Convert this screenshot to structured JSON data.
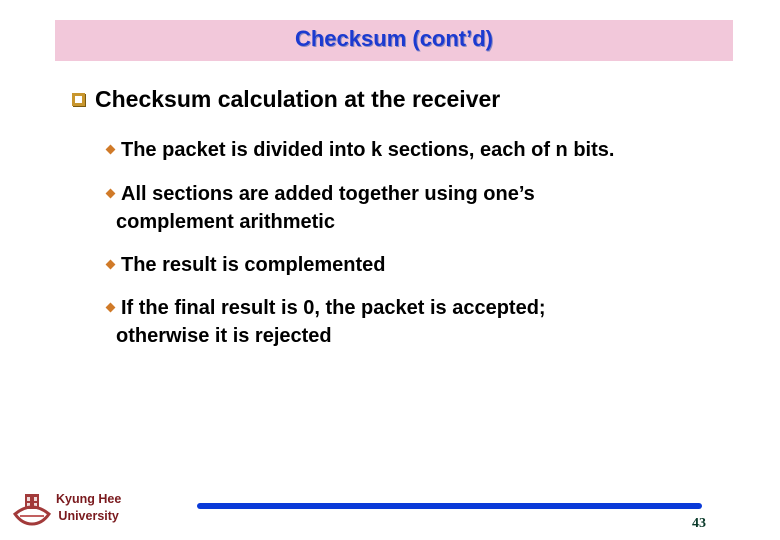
{
  "slide": {
    "title": "Checksum (cont’d)",
    "main_bullet": "Checksum calculation at the receiver",
    "sub_bullets": [
      {
        "line1": "The packet is divided into k sections, each of n bits.",
        "line2": ""
      },
      {
        "line1": "All sections are added together using one’s",
        "line2": "complement arithmetic"
      },
      {
        "line1": "The result is complemented",
        "line2": ""
      },
      {
        "line1": "If the final result is 0, the packet is accepted;",
        "line2": "otherwise it is rejected"
      }
    ]
  },
  "footer": {
    "university_line1": "Kyung Hee",
    "university_line2": "University",
    "page_number": "43"
  },
  "colors": {
    "title_bg": "#f2c8da",
    "title_text": "#1c3ad0",
    "bullet_square": "#c8962e",
    "bullet_diamond": "#d07a28",
    "footer_line": "#0a3ad8",
    "university_text": "#7a1a1e"
  }
}
